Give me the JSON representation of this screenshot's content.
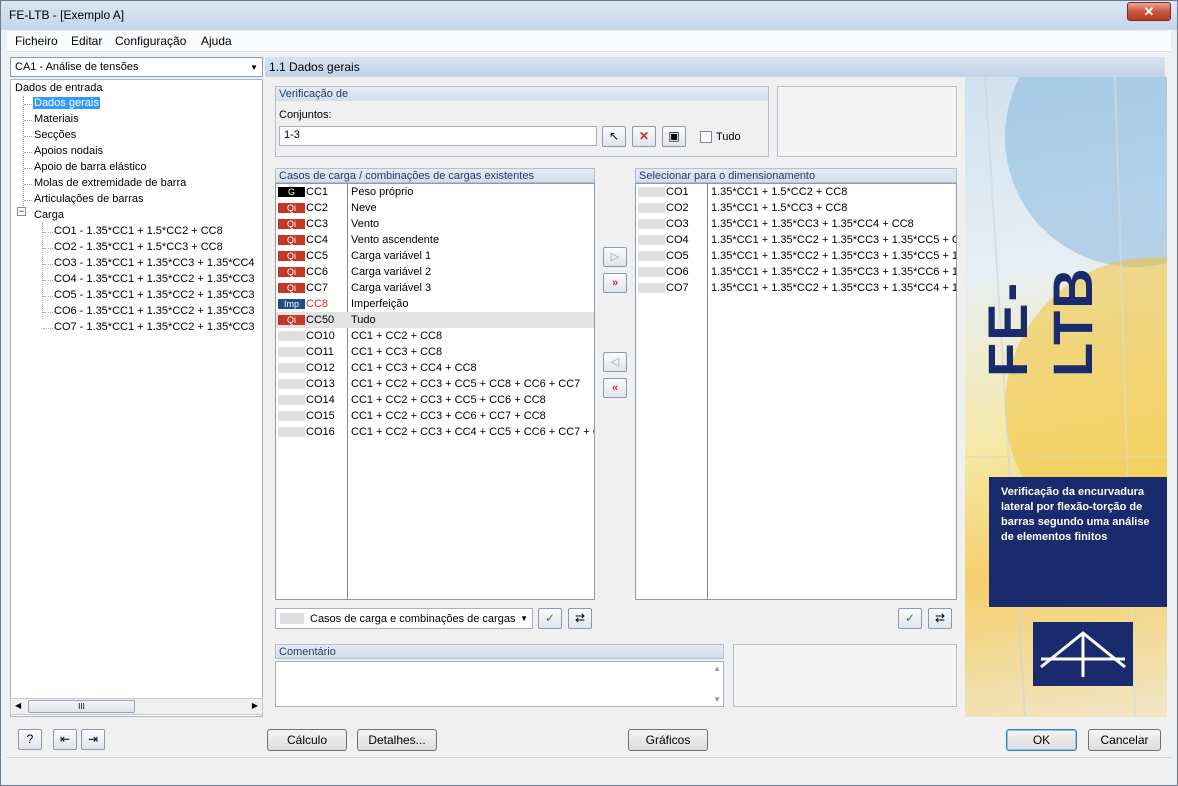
{
  "window": {
    "title": "FE-LTB - [Exemplo A]",
    "close": "✕"
  },
  "menu": [
    "Ficheiro",
    "Editar",
    "Configuração",
    "Ajuda"
  ],
  "case_combo": "CA1 - Análise de tensões",
  "tree": {
    "root": "Dados de entrada",
    "items": [
      "Dados gerais",
      "Materiais",
      "Secções",
      "Apoios nodais",
      "Apoio de barra elástico",
      "Molas de extremidade de barra",
      "Articulações de barras"
    ],
    "carga": "Carga",
    "carga_items": [
      "CO1 - 1.35*CC1 + 1.5*CC2 + CC8",
      "CO2 - 1.35*CC1 + 1.5*CC3 + CC8",
      "CO3 - 1.35*CC1 + 1.35*CC3 + 1.35*CC4",
      "CO4 - 1.35*CC1 + 1.35*CC2 + 1.35*CC3",
      "CO5 - 1.35*CC1 + 1.35*CC2 + 1.35*CC3",
      "CO6 - 1.35*CC1 + 1.35*CC2 + 1.35*CC3",
      "CO7 - 1.35*CC1 + 1.35*CC2 + 1.35*CC3"
    ],
    "scroll_thumb": "III"
  },
  "header": "1.1 Dados gerais",
  "verif": {
    "title": "Verificação de",
    "conjuntos_label": "Conjuntos:",
    "conjuntos_value": "1-3",
    "tudo": "Tudo"
  },
  "existing": {
    "title": "Casos de carga / combinações de cargas existentes",
    "rows": [
      {
        "tag": "G",
        "tagcolor": "#000000",
        "code": "CC1",
        "desc": "Peso próprio"
      },
      {
        "tag": "Qi",
        "tagcolor": "#c0392b",
        "code": "CC2",
        "desc": "Neve"
      },
      {
        "tag": "Qi",
        "tagcolor": "#c0392b",
        "code": "CC3",
        "desc": "Vento"
      },
      {
        "tag": "Qi",
        "tagcolor": "#c0392b",
        "code": "CC4",
        "desc": "Vento ascendente"
      },
      {
        "tag": "Qi",
        "tagcolor": "#c0392b",
        "code": "CC5",
        "desc": "Carga variável 1"
      },
      {
        "tag": "Qi",
        "tagcolor": "#c0392b",
        "code": "CC6",
        "desc": "Carga variável 2"
      },
      {
        "tag": "Qi",
        "tagcolor": "#c0392b",
        "code": "CC7",
        "desc": "Carga variável 3"
      },
      {
        "tag": "Imp",
        "tagcolor": "#1f4e8c",
        "code": "CC8",
        "desc": "Imperfeição"
      },
      {
        "tag": "Qi",
        "tagcolor": "#c0392b",
        "code": "CC50",
        "desc": "Tudo"
      },
      {
        "tag": "",
        "tagcolor": "#dedede",
        "code": "CO10",
        "desc": "CC1 + CC2 + CC8"
      },
      {
        "tag": "",
        "tagcolor": "#dedede",
        "code": "CO11",
        "desc": "CC1 + CC3 + CC8"
      },
      {
        "tag": "",
        "tagcolor": "#dedede",
        "code": "CO12",
        "desc": "CC1 + CC3 + CC4 + CC8"
      },
      {
        "tag": "",
        "tagcolor": "#dedede",
        "code": "CO13",
        "desc": "CC1 + CC2 + CC3 + CC5 + CC8 + CC6 + CC7"
      },
      {
        "tag": "",
        "tagcolor": "#dedede",
        "code": "CO14",
        "desc": "CC1 + CC2 + CC3 + CC5 + CC6 + CC8"
      },
      {
        "tag": "",
        "tagcolor": "#dedede",
        "code": "CO15",
        "desc": "CC1 + CC2 + CC3 + CC6 + CC7 + CC8"
      },
      {
        "tag": "",
        "tagcolor": "#dedede",
        "code": "CO16",
        "desc": "CC1 + CC2 + CC3 + CC4 + CC5 + CC6 + CC7 + CC"
      }
    ],
    "filter": "Casos de carga e combinações de cargas"
  },
  "selected": {
    "title": "Selecionar para o dimensionamento",
    "rows": [
      {
        "code": "CO1",
        "desc": "1.35*CC1 + 1.5*CC2 + CC8"
      },
      {
        "code": "CO2",
        "desc": "1.35*CC1 + 1.5*CC3 + CC8"
      },
      {
        "code": "CO3",
        "desc": "1.35*CC1 + 1.35*CC3 + 1.35*CC4 + CC8"
      },
      {
        "code": "CO4",
        "desc": "1.35*CC1 + 1.35*CC2 + 1.35*CC3 + 1.35*CC5 + C"
      },
      {
        "code": "CO5",
        "desc": "1.35*CC1 + 1.35*CC2 + 1.35*CC3 + 1.35*CC5 + 1."
      },
      {
        "code": "CO6",
        "desc": "1.35*CC1 + 1.35*CC2 + 1.35*CC3 + 1.35*CC6 + 1."
      },
      {
        "code": "CO7",
        "desc": "1.35*CC1 + 1.35*CC2 + 1.35*CC3 + 1.35*CC4 + 1."
      }
    ]
  },
  "comment": {
    "title": "Comentário"
  },
  "banner": {
    "logo": "FE-LTB",
    "text": "Verificação da encurvadura lateral por flexão-torção de barras segundo uma análise de elementos finitos"
  },
  "buttons": {
    "calc": "Cálculo",
    "details": "Detalhes...",
    "graphics": "Gráficos",
    "ok": "OK",
    "cancel": "Cancelar"
  }
}
